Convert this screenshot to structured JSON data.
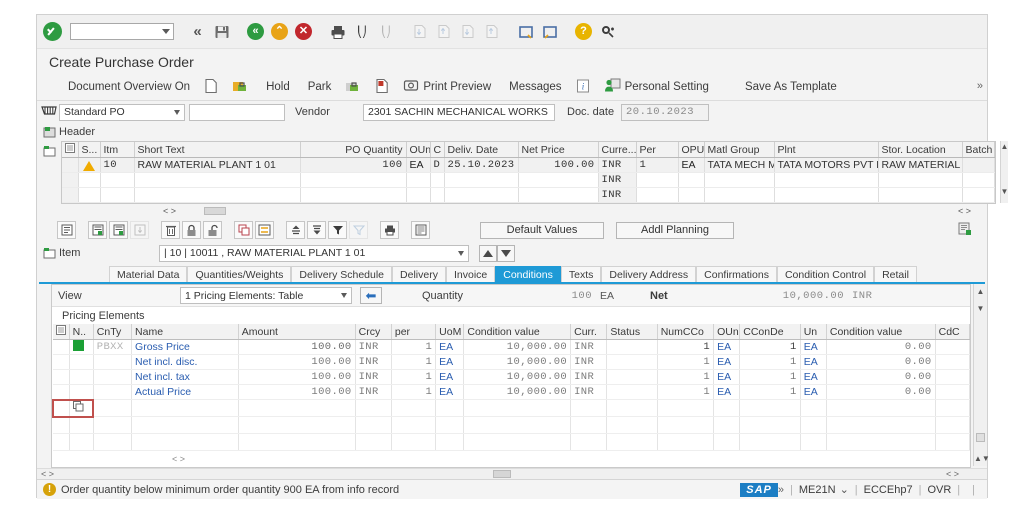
{
  "window": {
    "title": "Create Purchase Order",
    "command_field_value": ""
  },
  "system_toolbar": {
    "icons": [
      {
        "name": "enter-ok-icon",
        "glyph": "✔"
      },
      {
        "name": "command-dropdown-icon",
        "glyph": "▾"
      },
      {
        "name": "back-double-chevron-icon",
        "glyph": "«"
      },
      {
        "name": "save-icon",
        "glyph": "💾"
      },
      {
        "name": "back-icon",
        "glyph": "«"
      },
      {
        "name": "exit-icon",
        "glyph": "⌃"
      },
      {
        "name": "cancel-icon",
        "glyph": "✕"
      },
      {
        "name": "print-icon",
        "glyph": "⎙"
      },
      {
        "name": "find-icon",
        "glyph": "🔍"
      },
      {
        "name": "find-next-icon",
        "glyph": "🔍"
      },
      {
        "name": "first-page-icon",
        "glyph": "⇤"
      },
      {
        "name": "previous-page-icon",
        "glyph": "◁"
      },
      {
        "name": "next-page-icon",
        "glyph": "▷"
      },
      {
        "name": "last-page-icon",
        "glyph": "⇥"
      },
      {
        "name": "new-session-icon",
        "glyph": "❐"
      },
      {
        "name": "create-shortcut-icon",
        "glyph": "❐"
      },
      {
        "name": "help-icon",
        "glyph": "?"
      },
      {
        "name": "customize-layout-icon",
        "glyph": "⚙"
      }
    ]
  },
  "app_toolbar": {
    "items": [
      {
        "label": "Document Overview On",
        "icon": "document-overview-icon"
      },
      {
        "label": "",
        "icon": "new-document-icon"
      },
      {
        "label": "",
        "icon": "lock-folder-icon"
      },
      {
        "label": "Hold",
        "icon": "hold-icon"
      },
      {
        "label": "Park",
        "icon": "park-icon"
      },
      {
        "label": "",
        "icon": "unlock-icon"
      },
      {
        "label": "",
        "icon": "message-note-icon"
      },
      {
        "label": "Print Preview",
        "icon": "print-preview-icon"
      },
      {
        "label": "Messages",
        "icon": "messages-icon"
      },
      {
        "label": "",
        "icon": "info-icon"
      },
      {
        "label": "Personal Setting",
        "icon": "personal-setting-icon"
      },
      {
        "label": "Save As Template",
        "icon": "save-template-icon"
      }
    ],
    "expander": "»"
  },
  "header": {
    "doc_type": "Standard PO",
    "po_number": "",
    "vendor_label": "Vendor",
    "vendor_value": "2301 SACHIN MECHANICAL WORKS",
    "doc_date_label": "Doc. date",
    "doc_date_value": "20.10.2023",
    "header_section_label": "Header"
  },
  "item_grid": {
    "columns": [
      "",
      "S...",
      "Itm",
      "Short Text",
      "PO Quantity",
      "OUn",
      "C",
      "Deliv. Date",
      "Net Price",
      "Curre...",
      "Per",
      "OPU",
      "Matl Group",
      "Plnt",
      "Stor. Location",
      "Batch"
    ],
    "rows": [
      {
        "status_icon": "warning-triangle-icon",
        "itm": "10",
        "short_text": "RAW MATERIAL PLANT 1 01",
        "po_quantity": "100",
        "oun": "EA",
        "c": "D",
        "deliv_date": "25.10.2023",
        "net_price": "100.00",
        "currency": "INR",
        "per": "1",
        "opu": "EA",
        "matl_group": "TATA MECH M",
        "plant": "TATA MOTORS PVT LT",
        "stor_location": "RAW MATERIAL",
        "batch": ""
      },
      {
        "status_icon": "",
        "itm": "",
        "short_text": "",
        "po_quantity": "",
        "oun": "",
        "c": "",
        "deliv_date": "",
        "net_price": "",
        "currency": "INR",
        "per": "",
        "opu": "",
        "matl_group": "",
        "plant": "",
        "stor_location": "",
        "batch": ""
      },
      {
        "status_icon": "",
        "itm": "",
        "short_text": "",
        "po_quantity": "",
        "oun": "",
        "c": "",
        "deliv_date": "",
        "net_price": "",
        "currency": "INR",
        "per": "",
        "opu": "",
        "matl_group": "",
        "plant": "",
        "stor_location": "",
        "batch": ""
      }
    ]
  },
  "grid_toolbar": {
    "icons": [
      {
        "name": "detail-icon",
        "glyph": "▤"
      },
      {
        "name": "insert-row-icon",
        "glyph": "▤"
      },
      {
        "name": "copy-row-icon",
        "glyph": "▤"
      },
      {
        "name": "paste-row-icon",
        "glyph": "▤"
      },
      {
        "name": "delete-row-icon",
        "glyph": "🗑"
      },
      {
        "name": "lock-icon",
        "glyph": "🔒"
      },
      {
        "name": "unlock-icon",
        "glyph": "🔓"
      },
      {
        "name": "duplicate-icon",
        "glyph": "❐"
      },
      {
        "name": "exchange-icon",
        "glyph": "⇄"
      },
      {
        "name": "sort-ascending-icon",
        "glyph": "▲"
      },
      {
        "name": "sort-descending-icon",
        "glyph": "▼"
      },
      {
        "name": "filter-icon",
        "glyph": "▼"
      },
      {
        "name": "filter-off-icon",
        "glyph": "▽"
      },
      {
        "name": "print-grid-icon",
        "glyph": "⎙"
      },
      {
        "name": "layout-icon",
        "glyph": "▤"
      }
    ],
    "buttons": [
      {
        "label": "Default Values",
        "name": "default-values-button"
      },
      {
        "label": "Addl Planning",
        "name": "addl-planning-button"
      }
    ],
    "right_icon": "personal-config-icon"
  },
  "item_detail": {
    "label": "Item",
    "selector_value": "| 10 | 10011 , RAW MATERIAL PLANT 1 01",
    "nav_up": "▲",
    "nav_down": "▼",
    "tabs": [
      {
        "label": "Material Data",
        "active": false
      },
      {
        "label": "Quantities/Weights",
        "active": false
      },
      {
        "label": "Delivery Schedule",
        "active": false
      },
      {
        "label": "Delivery",
        "active": false
      },
      {
        "label": "Invoice",
        "active": false
      },
      {
        "label": "Conditions",
        "active": true
      },
      {
        "label": "Texts",
        "active": false
      },
      {
        "label": "Delivery Address",
        "active": false
      },
      {
        "label": "Confirmations",
        "active": false
      },
      {
        "label": "Condition Control",
        "active": false
      },
      {
        "label": "Retail",
        "active": false
      }
    ]
  },
  "conditions_view": {
    "view_label": "View",
    "view_value": "1 Pricing Elements: Table",
    "back_arrow_icon": "left-arrow-icon",
    "quantity_label": "Quantity",
    "quantity_value": "100",
    "quantity_uom": "EA",
    "net_label": "Net",
    "net_value": "10,000.00",
    "net_currency": "INR",
    "pricing_elements_label": "Pricing Elements"
  },
  "pricing_grid": {
    "columns": [
      "",
      "N..",
      "CnTy",
      "Name",
      "Amount",
      "Crcy",
      "per",
      "UoM",
      "Condition value",
      "Curr.",
      "Status",
      "NumCCo",
      "OUn",
      "CConDe",
      "Un",
      "Condition value",
      "CdC"
    ],
    "rows": [
      {
        "marker": "green",
        "n": "",
        "cnty": "PBXX",
        "name": "Gross Price",
        "amount": "100.00",
        "crcy": "INR",
        "per": "1",
        "uom": "EA",
        "condition_value": "10,000.00",
        "curr": "INR",
        "status": "",
        "numcco": "1",
        "oun": "EA",
        "cconde": "1",
        "un": "EA",
        "condition_value2": "0.00",
        "cdc": ""
      },
      {
        "marker": "",
        "n": "",
        "cnty": "",
        "name": "Net incl. disc.",
        "amount": "100.00",
        "crcy": "INR",
        "per": "1",
        "uom": "EA",
        "condition_value": "10,000.00",
        "curr": "INR",
        "status": "",
        "numcco": "1",
        "oun": "EA",
        "cconde": "1",
        "un": "EA",
        "condition_value2": "0.00",
        "cdc": ""
      },
      {
        "marker": "",
        "n": "",
        "cnty": "",
        "name": "Net incl. tax",
        "amount": "100.00",
        "crcy": "INR",
        "per": "1",
        "uom": "EA",
        "condition_value": "10,000.00",
        "curr": "INR",
        "status": "",
        "numcco": "1",
        "oun": "EA",
        "cconde": "1",
        "un": "EA",
        "condition_value2": "0.00",
        "cdc": ""
      },
      {
        "marker": "",
        "n": "",
        "cnty": "",
        "name": "Actual Price",
        "amount": "100.00",
        "crcy": "INR",
        "per": "1",
        "uom": "EA",
        "condition_value": "10,000.00",
        "curr": "INR",
        "status": "",
        "numcco": "1",
        "oun": "EA",
        "cconde": "1",
        "un": "EA",
        "condition_value2": "0.00",
        "cdc": ""
      }
    ]
  },
  "status_bar": {
    "message": "Order quantity below minimum order quantity 900 EA from info record",
    "message_icon": "warning-icon",
    "brand": "SAP",
    "expander": "»",
    "transaction": "ME21N",
    "system": "ECCEhp7",
    "insert_mode": "OVR"
  }
}
